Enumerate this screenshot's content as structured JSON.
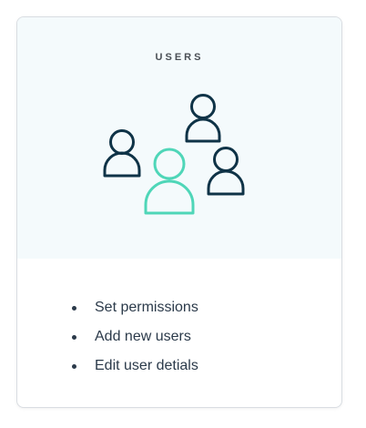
{
  "card": {
    "title": "USERS",
    "features": [
      "Set permissions",
      "Add new users",
      "Edit user detials"
    ]
  },
  "colors": {
    "dark_user": "#0f3347",
    "accent_user": "#4fd6b8",
    "header_bg": "#f4fafc"
  },
  "icons": [
    "user-group-illustration",
    "user-icon"
  ]
}
